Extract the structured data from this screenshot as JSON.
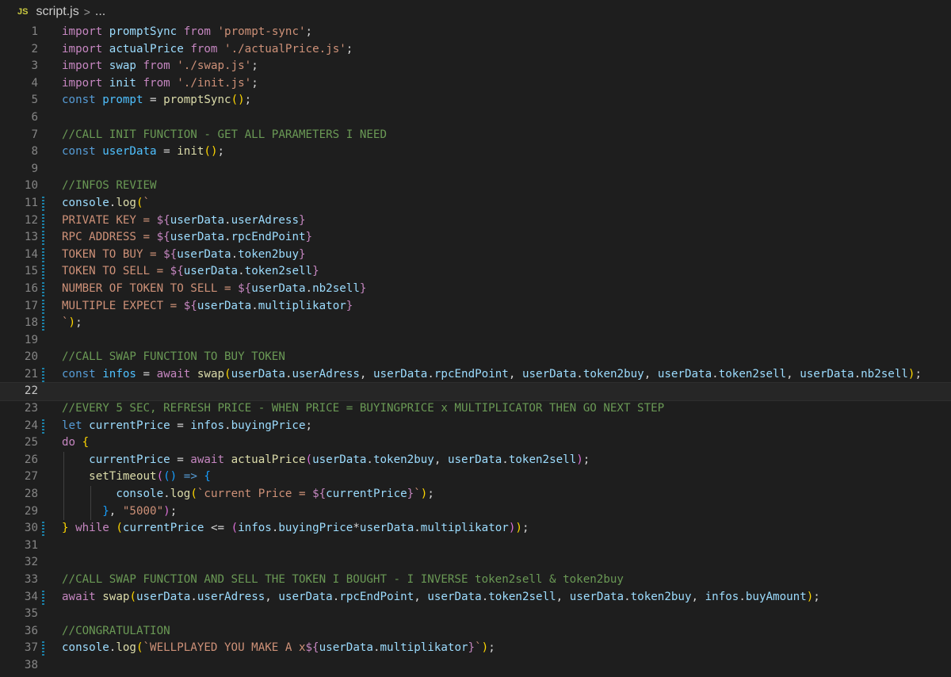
{
  "breadcrumb": {
    "file_icon": "JS",
    "file_name": "script.js",
    "separator": ">",
    "rest": "..."
  },
  "editor": {
    "active_line": 22,
    "lines": [
      {
        "n": "1",
        "tokens": [
          [
            "kw",
            "import"
          ],
          [
            "op",
            " "
          ],
          [
            "id",
            "promptSync"
          ],
          [
            "op",
            " "
          ],
          [
            "kw",
            "from"
          ],
          [
            "op",
            " "
          ],
          [
            "str",
            "'prompt-sync'"
          ],
          [
            "op",
            ";"
          ]
        ]
      },
      {
        "n": "2",
        "tokens": [
          [
            "kw",
            "import"
          ],
          [
            "op",
            " "
          ],
          [
            "id",
            "actualPrice"
          ],
          [
            "op",
            " "
          ],
          [
            "kw",
            "from"
          ],
          [
            "op",
            " "
          ],
          [
            "str",
            "'./actualPrice.js'"
          ],
          [
            "op",
            ";"
          ]
        ]
      },
      {
        "n": "3",
        "tokens": [
          [
            "kw",
            "import"
          ],
          [
            "op",
            " "
          ],
          [
            "id",
            "swap"
          ],
          [
            "op",
            " "
          ],
          [
            "kw",
            "from"
          ],
          [
            "op",
            " "
          ],
          [
            "str",
            "'./swap.js'"
          ],
          [
            "op",
            ";"
          ]
        ]
      },
      {
        "n": "4",
        "tokens": [
          [
            "kw",
            "import"
          ],
          [
            "op",
            " "
          ],
          [
            "id",
            "init"
          ],
          [
            "op",
            " "
          ],
          [
            "kw",
            "from"
          ],
          [
            "op",
            " "
          ],
          [
            "str",
            "'./init.js'"
          ],
          [
            "op",
            ";"
          ]
        ]
      },
      {
        "n": "5",
        "tokens": [
          [
            "st",
            "const"
          ],
          [
            "op",
            " "
          ],
          [
            "cst",
            "prompt"
          ],
          [
            "op",
            " = "
          ],
          [
            "fn",
            "promptSync"
          ],
          [
            "b1",
            "()"
          ],
          [
            "op",
            ";"
          ]
        ]
      },
      {
        "n": "6",
        "tokens": []
      },
      {
        "n": "7",
        "tokens": [
          [
            "cm",
            "//CALL INIT FUNCTION - GET ALL PARAMETERS I NEED"
          ]
        ]
      },
      {
        "n": "8",
        "tokens": [
          [
            "st",
            "const"
          ],
          [
            "op",
            " "
          ],
          [
            "cst",
            "userData"
          ],
          [
            "op",
            " = "
          ],
          [
            "fn",
            "init"
          ],
          [
            "b1",
            "()"
          ],
          [
            "op",
            ";"
          ]
        ]
      },
      {
        "n": "9",
        "tokens": []
      },
      {
        "n": "10",
        "tokens": [
          [
            "cm",
            "//INFOS REVIEW"
          ]
        ]
      },
      {
        "n": "11",
        "git": true,
        "tokens": [
          [
            "id",
            "console"
          ],
          [
            "op",
            "."
          ],
          [
            "fn",
            "log"
          ],
          [
            "b1",
            "("
          ],
          [
            "str",
            "`"
          ]
        ]
      },
      {
        "n": "12",
        "git": true,
        "tokens": [
          [
            "str",
            "PRIVATE KEY = "
          ],
          [
            "tpl",
            "${"
          ],
          [
            "id",
            "userData"
          ],
          [
            "op",
            "."
          ],
          [
            "id",
            "userAdress"
          ],
          [
            "tpl",
            "}"
          ]
        ]
      },
      {
        "n": "13",
        "git": true,
        "tokens": [
          [
            "str",
            "RPC ADDRESS = "
          ],
          [
            "tpl",
            "${"
          ],
          [
            "id",
            "userData"
          ],
          [
            "op",
            "."
          ],
          [
            "id",
            "rpcEndPoint"
          ],
          [
            "tpl",
            "}"
          ]
        ]
      },
      {
        "n": "14",
        "git": true,
        "tokens": [
          [
            "str",
            "TOKEN TO BUY = "
          ],
          [
            "tpl",
            "${"
          ],
          [
            "id",
            "userData"
          ],
          [
            "op",
            "."
          ],
          [
            "id",
            "token2buy"
          ],
          [
            "tpl",
            "}"
          ]
        ]
      },
      {
        "n": "15",
        "git": true,
        "tokens": [
          [
            "str",
            "TOKEN TO SELL = "
          ],
          [
            "tpl",
            "${"
          ],
          [
            "id",
            "userData"
          ],
          [
            "op",
            "."
          ],
          [
            "id",
            "token2sell"
          ],
          [
            "tpl",
            "}"
          ]
        ]
      },
      {
        "n": "16",
        "git": true,
        "tokens": [
          [
            "str",
            "NUMBER OF TOKEN TO SELL = "
          ],
          [
            "tpl",
            "${"
          ],
          [
            "id",
            "userData"
          ],
          [
            "op",
            "."
          ],
          [
            "id",
            "nb2sell"
          ],
          [
            "tpl",
            "}"
          ]
        ]
      },
      {
        "n": "17",
        "git": true,
        "tokens": [
          [
            "str",
            "MULTIPLE EXPECT = "
          ],
          [
            "tpl",
            "${"
          ],
          [
            "id",
            "userData"
          ],
          [
            "op",
            "."
          ],
          [
            "id",
            "multiplikator"
          ],
          [
            "tpl",
            "}"
          ]
        ]
      },
      {
        "n": "18",
        "git": true,
        "tokens": [
          [
            "str",
            "`"
          ],
          [
            "b1",
            ")"
          ],
          [
            "op",
            ";"
          ]
        ]
      },
      {
        "n": "19",
        "tokens": []
      },
      {
        "n": "20",
        "tokens": [
          [
            "cm",
            "//CALL SWAP FUNCTION TO BUY TOKEN"
          ]
        ]
      },
      {
        "n": "21",
        "git": true,
        "tokens": [
          [
            "st",
            "const"
          ],
          [
            "op",
            " "
          ],
          [
            "cst",
            "infos"
          ],
          [
            "op",
            " = "
          ],
          [
            "kw",
            "await"
          ],
          [
            "op",
            " "
          ],
          [
            "fn",
            "swap"
          ],
          [
            "b1",
            "("
          ],
          [
            "id",
            "userData"
          ],
          [
            "op",
            "."
          ],
          [
            "id",
            "userAdress"
          ],
          [
            "op",
            ", "
          ],
          [
            "id",
            "userData"
          ],
          [
            "op",
            "."
          ],
          [
            "id",
            "rpcEndPoint"
          ],
          [
            "op",
            ", "
          ],
          [
            "id",
            "userData"
          ],
          [
            "op",
            "."
          ],
          [
            "id",
            "token2buy"
          ],
          [
            "op",
            ", "
          ],
          [
            "id",
            "userData"
          ],
          [
            "op",
            "."
          ],
          [
            "id",
            "token2sell"
          ],
          [
            "op",
            ", "
          ],
          [
            "id",
            "userData"
          ],
          [
            "op",
            "."
          ],
          [
            "id",
            "nb2sell"
          ],
          [
            "b1",
            ")"
          ],
          [
            "op",
            ";"
          ]
        ]
      },
      {
        "n": "22",
        "tokens": []
      },
      {
        "n": "23",
        "tokens": [
          [
            "cm",
            "//EVERY 5 SEC, REFRESH PRICE - WHEN PRICE = BUYINGPRICE x MULTIPLICATOR THEN GO NEXT STEP"
          ]
        ]
      },
      {
        "n": "24",
        "git": true,
        "tokens": [
          [
            "st",
            "let"
          ],
          [
            "op",
            " "
          ],
          [
            "id",
            "currentPrice"
          ],
          [
            "op",
            " = "
          ],
          [
            "id",
            "infos"
          ],
          [
            "op",
            "."
          ],
          [
            "id",
            "buyingPrice"
          ],
          [
            "op",
            ";"
          ]
        ]
      },
      {
        "n": "25",
        "tokens": [
          [
            "kw",
            "do"
          ],
          [
            "op",
            " "
          ],
          [
            "b1",
            "{"
          ]
        ]
      },
      {
        "n": "26",
        "indent": 1,
        "tokens": [
          [
            "op",
            "    "
          ],
          [
            "id",
            "currentPrice"
          ],
          [
            "op",
            " = "
          ],
          [
            "kw",
            "await"
          ],
          [
            "op",
            " "
          ],
          [
            "fn",
            "actualPrice"
          ],
          [
            "b2",
            "("
          ],
          [
            "id",
            "userData"
          ],
          [
            "op",
            "."
          ],
          [
            "id",
            "token2buy"
          ],
          [
            "op",
            ", "
          ],
          [
            "id",
            "userData"
          ],
          [
            "op",
            "."
          ],
          [
            "id",
            "token2sell"
          ],
          [
            "b2",
            ")"
          ],
          [
            "op",
            ";"
          ]
        ]
      },
      {
        "n": "27",
        "indent": 1,
        "tokens": [
          [
            "op",
            "    "
          ],
          [
            "fn",
            "setTimeout"
          ],
          [
            "b2",
            "("
          ],
          [
            "b3",
            "()"
          ],
          [
            "op",
            " "
          ],
          [
            "st",
            "=>"
          ],
          [
            "op",
            " "
          ],
          [
            "b3",
            "{"
          ]
        ]
      },
      {
        "n": "28",
        "indent": 2,
        "tokens": [
          [
            "op",
            "        "
          ],
          [
            "id",
            "console"
          ],
          [
            "op",
            "."
          ],
          [
            "fn",
            "log"
          ],
          [
            "b1",
            "("
          ],
          [
            "str",
            "`current Price = "
          ],
          [
            "tpl",
            "${"
          ],
          [
            "id",
            "currentPrice"
          ],
          [
            "tpl",
            "}"
          ],
          [
            "str",
            "`"
          ],
          [
            "b1",
            ")"
          ],
          [
            "op",
            ";"
          ]
        ]
      },
      {
        "n": "29",
        "indent": 2,
        "tokens": [
          [
            "op",
            "      "
          ],
          [
            "b3",
            "}"
          ],
          [
            "op",
            ", "
          ],
          [
            "str",
            "\"5000\""
          ],
          [
            "b2",
            ")"
          ],
          [
            "op",
            ";"
          ]
        ]
      },
      {
        "n": "30",
        "git": true,
        "tokens": [
          [
            "b1",
            "}"
          ],
          [
            "op",
            " "
          ],
          [
            "kw",
            "while"
          ],
          [
            "op",
            " "
          ],
          [
            "b1",
            "("
          ],
          [
            "id",
            "currentPrice"
          ],
          [
            "op",
            " <= "
          ],
          [
            "b2",
            "("
          ],
          [
            "id",
            "infos"
          ],
          [
            "op",
            "."
          ],
          [
            "id",
            "buyingPrice"
          ],
          [
            "op",
            "*"
          ],
          [
            "id",
            "userData"
          ],
          [
            "op",
            "."
          ],
          [
            "id",
            "multiplikator"
          ],
          [
            "b2",
            ")"
          ],
          [
            "b1",
            ")"
          ],
          [
            "op",
            ";"
          ]
        ]
      },
      {
        "n": "31",
        "tokens": []
      },
      {
        "n": "32",
        "tokens": []
      },
      {
        "n": "33",
        "tokens": [
          [
            "cm",
            "//CALL SWAP FUNCTION AND SELL THE TOKEN I BOUGHT - I INVERSE token2sell & token2buy"
          ]
        ]
      },
      {
        "n": "34",
        "git": true,
        "tokens": [
          [
            "kw",
            "await"
          ],
          [
            "op",
            " "
          ],
          [
            "fn",
            "swap"
          ],
          [
            "b1",
            "("
          ],
          [
            "id",
            "userData"
          ],
          [
            "op",
            "."
          ],
          [
            "id",
            "userAdress"
          ],
          [
            "op",
            ", "
          ],
          [
            "id",
            "userData"
          ],
          [
            "op",
            "."
          ],
          [
            "id",
            "rpcEndPoint"
          ],
          [
            "op",
            ", "
          ],
          [
            "id",
            "userData"
          ],
          [
            "op",
            "."
          ],
          [
            "id",
            "token2sell"
          ],
          [
            "op",
            ", "
          ],
          [
            "id",
            "userData"
          ],
          [
            "op",
            "."
          ],
          [
            "id",
            "token2buy"
          ],
          [
            "op",
            ", "
          ],
          [
            "id",
            "infos"
          ],
          [
            "op",
            "."
          ],
          [
            "id",
            "buyAmount"
          ],
          [
            "b1",
            ")"
          ],
          [
            "op",
            ";"
          ]
        ]
      },
      {
        "n": "35",
        "tokens": []
      },
      {
        "n": "36",
        "tokens": [
          [
            "cm",
            "//CONGRATULATION"
          ]
        ]
      },
      {
        "n": "37",
        "git": true,
        "tokens": [
          [
            "id",
            "console"
          ],
          [
            "op",
            "."
          ],
          [
            "fn",
            "log"
          ],
          [
            "b1",
            "("
          ],
          [
            "str",
            "`WELLPLAYED YOU MAKE A x"
          ],
          [
            "tpl",
            "${"
          ],
          [
            "id",
            "userData"
          ],
          [
            "op",
            "."
          ],
          [
            "id",
            "multiplikator"
          ],
          [
            "tpl",
            "}"
          ],
          [
            "str",
            "`"
          ],
          [
            "b1",
            ")"
          ],
          [
            "op",
            ";"
          ]
        ]
      },
      {
        "n": "38",
        "tokens": []
      }
    ]
  }
}
